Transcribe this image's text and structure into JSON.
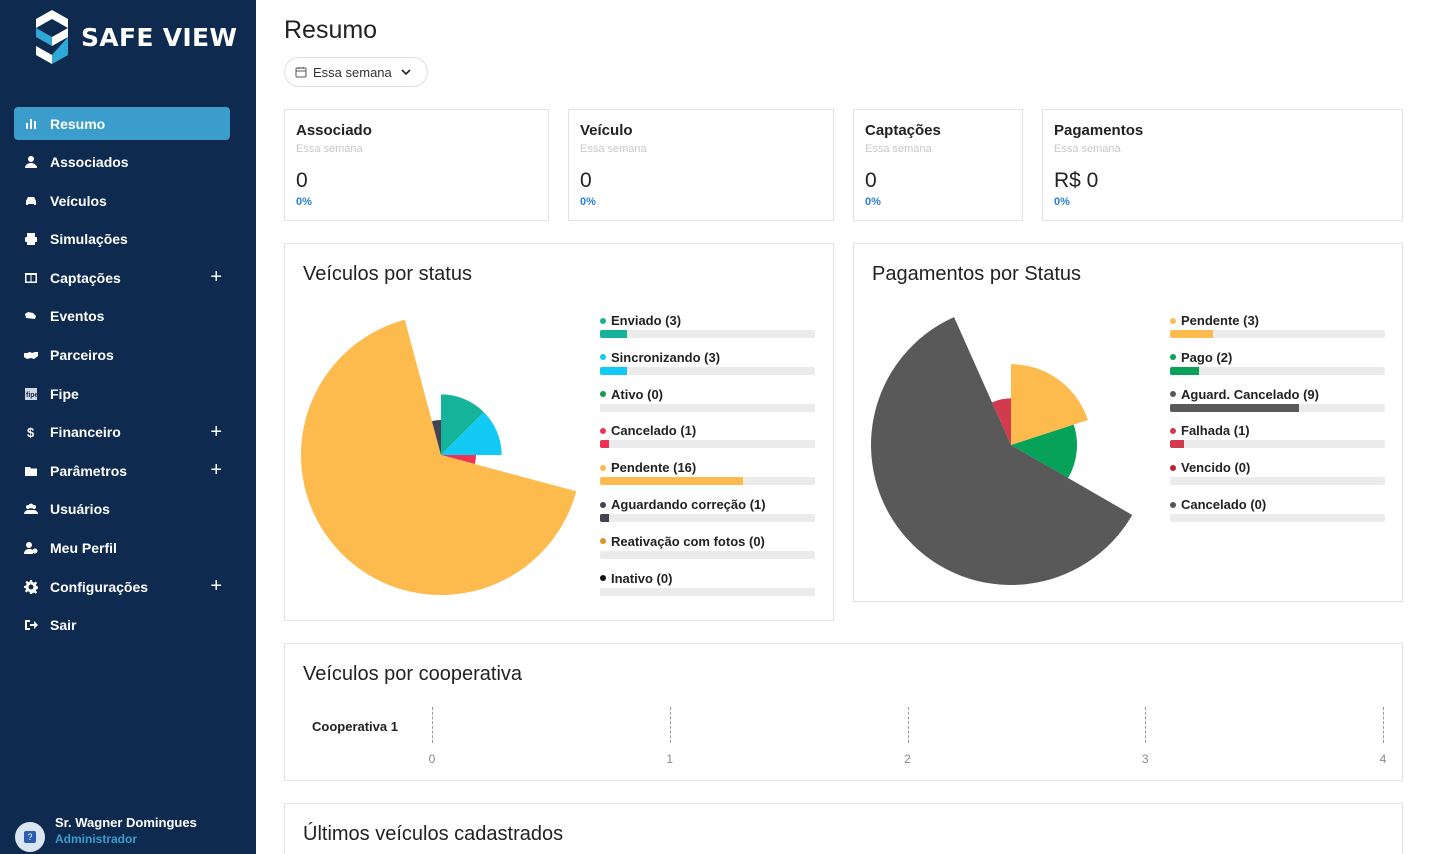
{
  "app": {
    "name": "SAFE VIEW"
  },
  "sidebar": {
    "items": [
      {
        "label": "Resumo",
        "icon": "bar-chart-icon",
        "active": true,
        "expandable": false
      },
      {
        "label": "Associados",
        "icon": "user-icon",
        "active": false,
        "expandable": false
      },
      {
        "label": "Veículos",
        "icon": "car-icon",
        "active": false,
        "expandable": false
      },
      {
        "label": "Simulações",
        "icon": "print-icon",
        "active": false,
        "expandable": false
      },
      {
        "label": "Captações",
        "icon": "columns-icon",
        "active": false,
        "expandable": true
      },
      {
        "label": "Eventos",
        "icon": "car-crash-icon",
        "active": false,
        "expandable": false
      },
      {
        "label": "Parceiros",
        "icon": "handshake-icon",
        "active": false,
        "expandable": false
      },
      {
        "label": "Fipe",
        "icon": "fipe-icon",
        "active": false,
        "expandable": false
      },
      {
        "label": "Financeiro",
        "icon": "dollar-icon",
        "active": false,
        "expandable": true
      },
      {
        "label": "Parâmetros",
        "icon": "folder-icon",
        "active": false,
        "expandable": true
      },
      {
        "label": "Usuários",
        "icon": "users-icon",
        "active": false,
        "expandable": false
      },
      {
        "label": "Meu Perfil",
        "icon": "user-cog-icon",
        "active": false,
        "expandable": false
      },
      {
        "label": "Configurações",
        "icon": "gear-icon",
        "active": false,
        "expandable": true
      },
      {
        "label": "Sair",
        "icon": "sign-out-icon",
        "active": false,
        "expandable": false
      }
    ],
    "user": {
      "name": "Sr. Wagner Domingues",
      "role": "Administrador"
    }
  },
  "main": {
    "title": "Resumo",
    "period": "Essa semana",
    "stats": [
      {
        "title": "Associado",
        "subtitle": "Essa semana",
        "value": "0",
        "pct": "0%"
      },
      {
        "title": "Veículo",
        "subtitle": "Essa semana",
        "value": "0",
        "pct": "0%"
      },
      {
        "title": "Captações",
        "subtitle": "Essa semana",
        "value": "0",
        "pct": "0%"
      },
      {
        "title": "Pagamentos",
        "subtitle": "Essa semana",
        "value": "R$ 0",
        "pct": "0%"
      }
    ],
    "panels": {
      "vehicles_status": "Veículos por status",
      "payments_status": "Pagamentos por Status",
      "cooperative": "Veículos por cooperativa",
      "latest": "Últimos veículos cadastrados"
    }
  },
  "chart_data": [
    {
      "type": "pie",
      "title": "Veículos por status",
      "categories": [
        "Enviado (3)",
        "Sincronizando (3)",
        "Ativo (0)",
        "Cancelado (1)",
        "Pendente (16)",
        "Aguardando correção (1)",
        "Reativação com fotos (0)",
        "Inativo (0)"
      ],
      "values": [
        3,
        3,
        0,
        1,
        16,
        1,
        0,
        0
      ],
      "colors": [
        "#14b39a",
        "#12c8f4",
        "#139a4a",
        "#ee3355",
        "#fdba4d",
        "#424250",
        "#e29327",
        "#111111"
      ],
      "legend": "right"
    },
    {
      "type": "pie",
      "title": "Pagamentos por Status",
      "categories": [
        "Pendente (3)",
        "Pago (2)",
        "Aguard. Cancelado (9)",
        "Falhada (1)",
        "Vencido (0)",
        "Cancelado (0)"
      ],
      "values": [
        3,
        2,
        9,
        1,
        0,
        0
      ],
      "colors": [
        "#fdba4d",
        "#06a25a",
        "#595959",
        "#d23a4e",
        "#c21f37",
        "#555555"
      ],
      "legend": "right"
    },
    {
      "type": "bar",
      "title": "Veículos por cooperativa",
      "categories": [
        "Cooperativa 1"
      ],
      "values": [
        0
      ],
      "xticks": [
        "0",
        "1",
        "2",
        "3",
        "4"
      ],
      "xlim": [
        0,
        4
      ]
    }
  ]
}
